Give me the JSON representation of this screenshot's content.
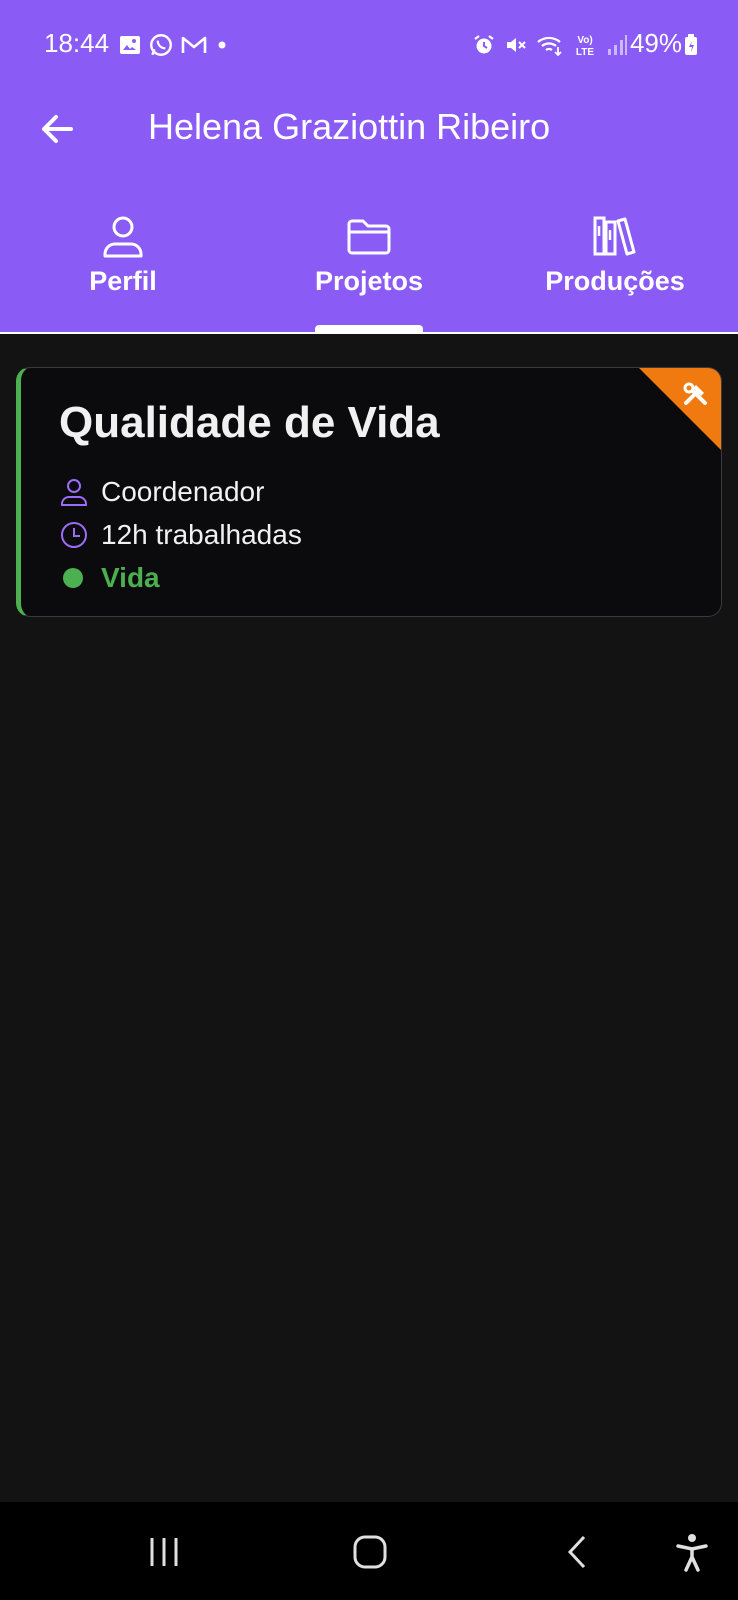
{
  "status_bar": {
    "time": "18:44",
    "battery": "49%",
    "left_icons": [
      "gallery-icon",
      "whatsapp-icon",
      "gmail-icon",
      "dot-icon"
    ],
    "right_icons": [
      "alarm-icon",
      "mute-icon",
      "wifi-icon",
      "volte-icon",
      "signal-icon",
      "battery-icon"
    ]
  },
  "app_bar": {
    "back_icon": "arrow-left-icon",
    "title": "Helena Graziottin Ribeiro"
  },
  "tabs": [
    {
      "label": "Perfil",
      "icon": "person-icon",
      "selected": false
    },
    {
      "label": "Projetos",
      "icon": "folder-icon",
      "selected": true
    },
    {
      "label": "Produções",
      "icon": "books-icon",
      "selected": false
    }
  ],
  "project_card": {
    "title": "Qualidade de Vida",
    "role": "Coordenador",
    "hours": "12h trabalhadas",
    "area": "Vida",
    "accent_color": "#4caf50",
    "corner_color": "#f07a10",
    "corner_icon": "tools-icon"
  },
  "colors": {
    "header": "#8a5cf5",
    "background": "#131313",
    "icon_purple": "#9b6cf7"
  },
  "nav_bar": {
    "buttons": [
      "recents-icon",
      "home-icon",
      "back-icon",
      "accessibility-icon"
    ]
  }
}
